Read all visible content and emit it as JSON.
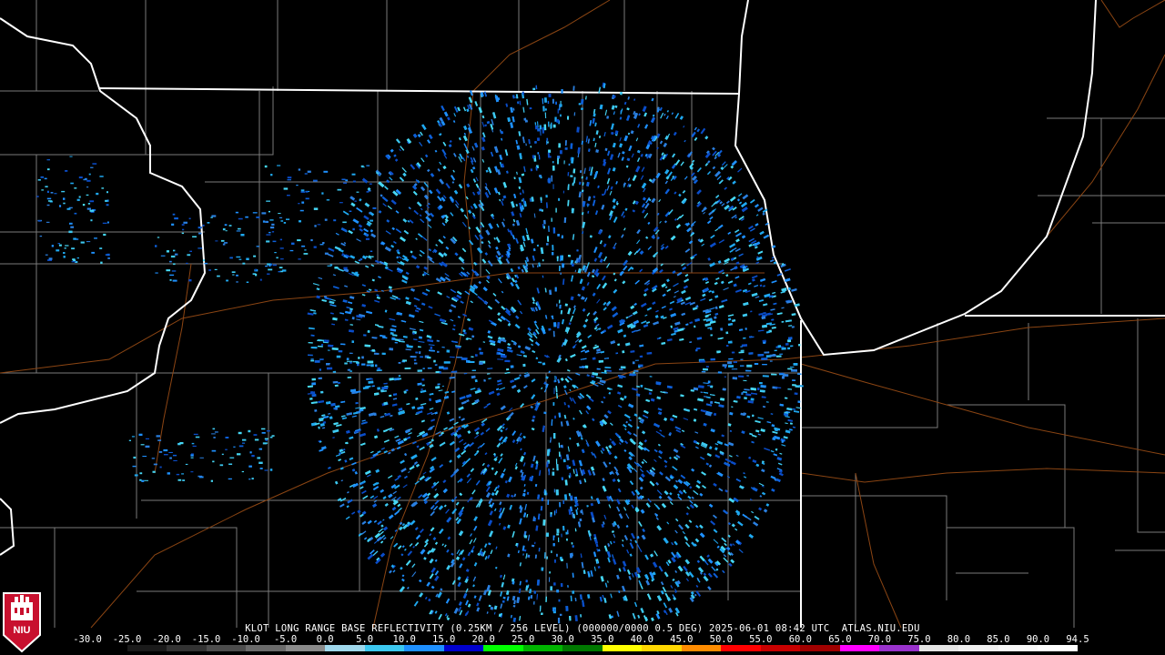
{
  "product": {
    "title": "KLOT LONG RANGE BASE REFLECTIVITY (0.25KM / 256 LEVEL) (000000/0000 0.5 DEG) 2025-06-01 08:42 UTC  ATLAS.NIU.EDU"
  },
  "logo": {
    "text": "NIU",
    "color": "#c8102e"
  },
  "colorscale": {
    "labels": [
      "-30.0",
      "-25.0",
      "-20.0",
      "-15.0",
      "-10.0",
      "-5.0",
      "0.0",
      "5.0",
      "10.0",
      "15.0",
      "20.0",
      "25.0",
      "30.0",
      "35.0",
      "40.0",
      "45.0",
      "50.0",
      "55.0",
      "60.0",
      "65.0",
      "70.0",
      "75.0",
      "80.0",
      "85.0",
      "90.0",
      "94.5"
    ],
    "colors": [
      "#000000",
      "#1a1a1a",
      "#333333",
      "#4d4d4d",
      "#6b6b6b",
      "#8a8a8a",
      "#9fd8ec",
      "#3cc8f0",
      "#1e90ff",
      "#0000cd",
      "#00ff00",
      "#00b400",
      "#007800",
      "#ffff00",
      "#ffd700",
      "#ff8c00",
      "#ff0000",
      "#c80000",
      "#a00000",
      "#ff00ff",
      "#9932cc",
      "#e6e6e6",
      "#f0f0f0",
      "#f8f8f8",
      "#ffffff"
    ]
  },
  "map": {
    "radar_site": "KLOT",
    "state_border_color": "#ffffff",
    "county_border_color": "#7f7f7f",
    "highway_color": "#8b4513"
  }
}
